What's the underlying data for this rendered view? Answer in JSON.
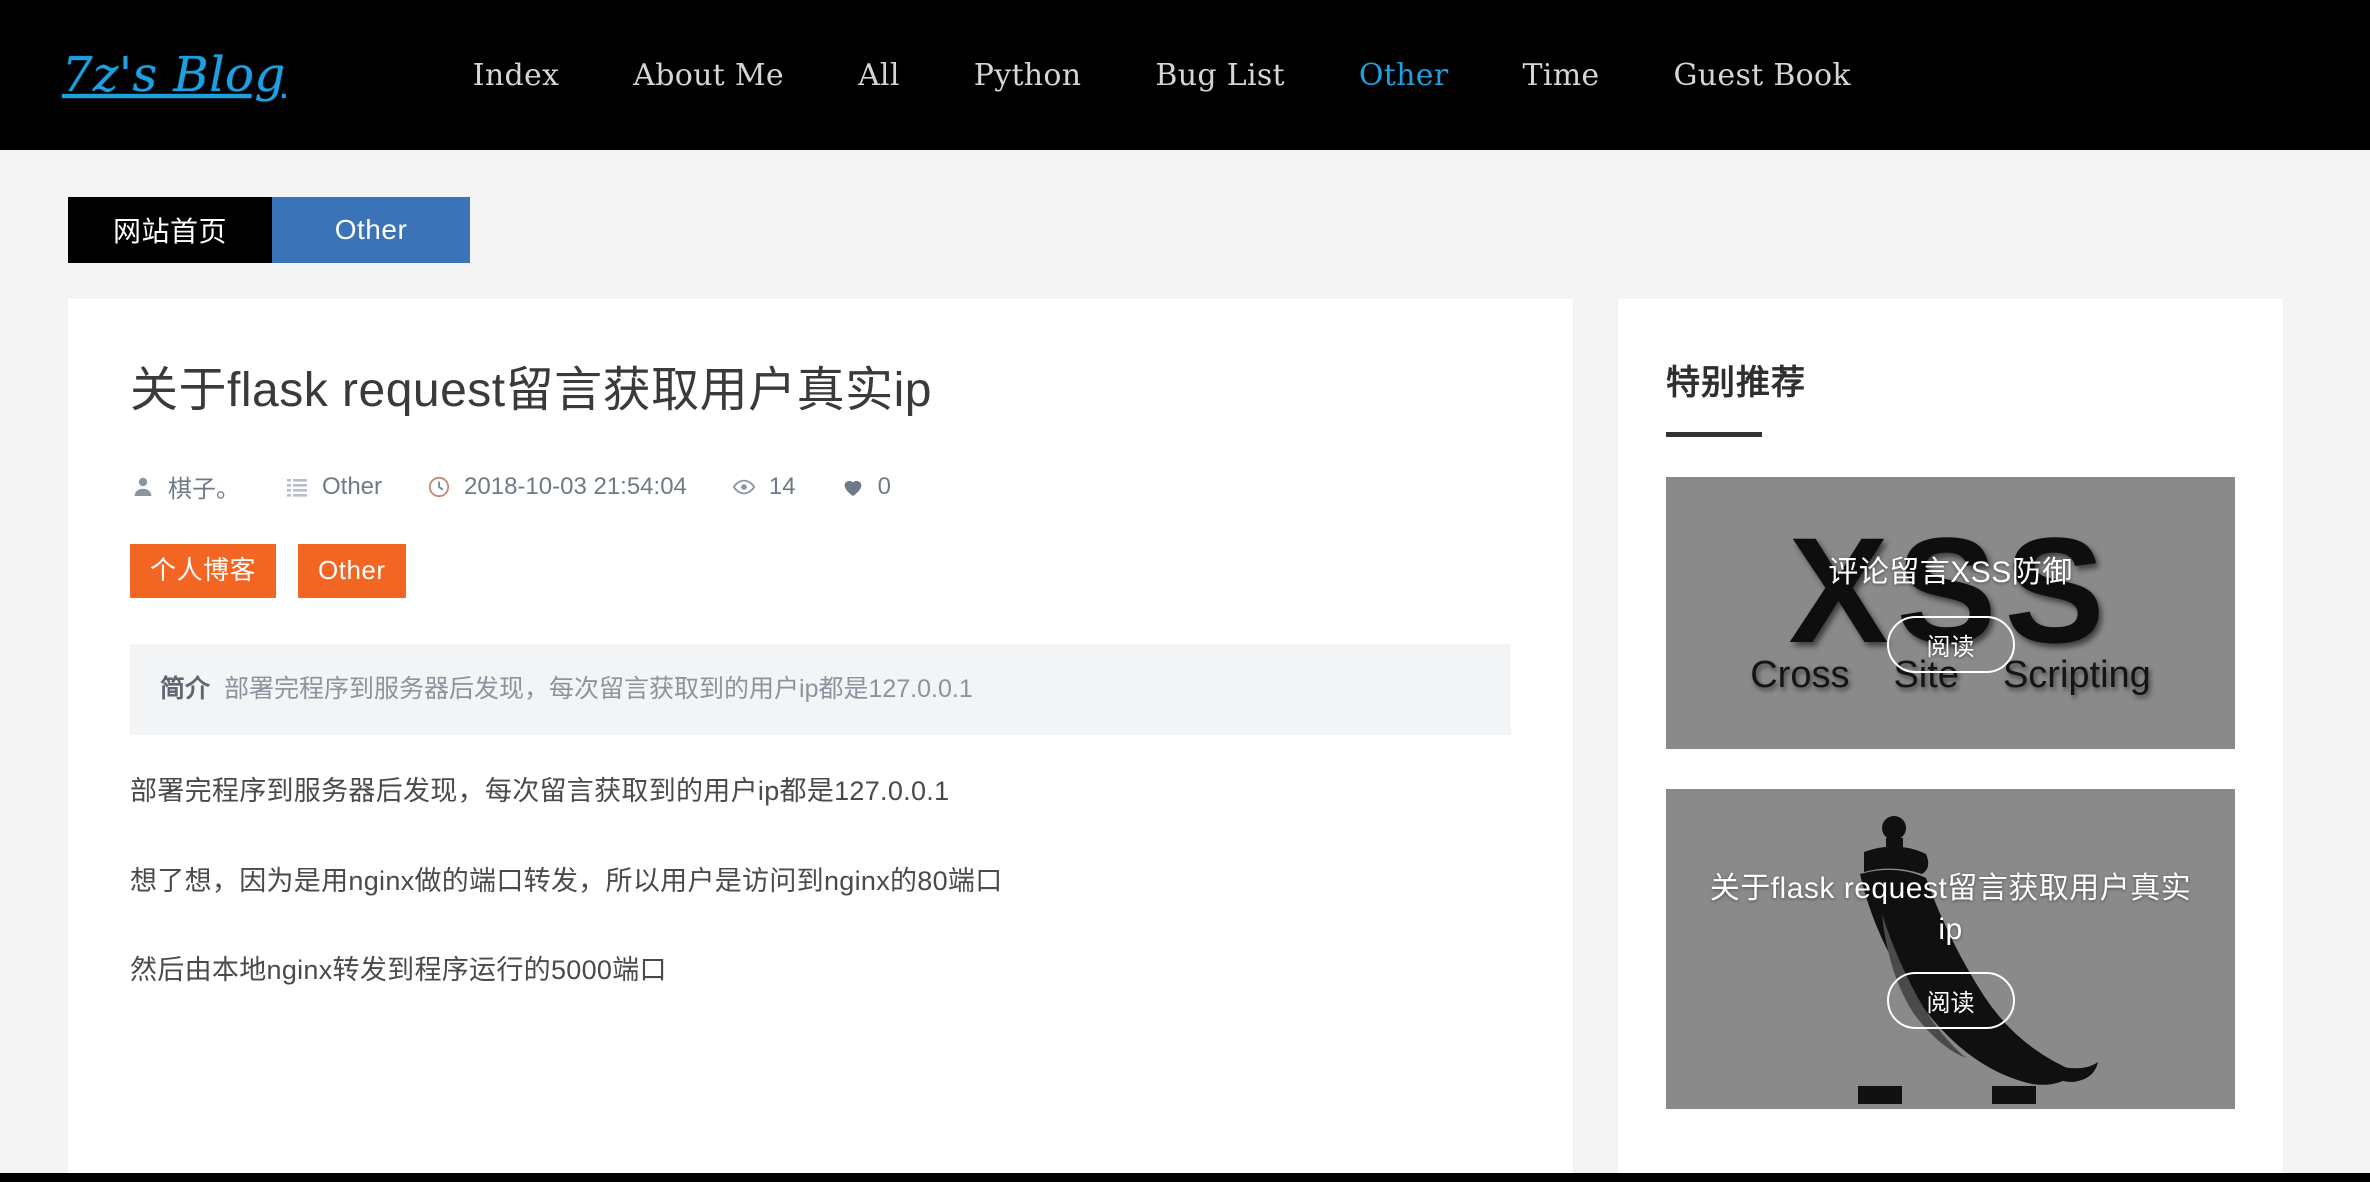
{
  "header": {
    "brand": "7z's Blog",
    "nav": [
      {
        "label": "Index",
        "active": false
      },
      {
        "label": "About Me",
        "active": false
      },
      {
        "label": "All",
        "active": false
      },
      {
        "label": "Python",
        "active": false
      },
      {
        "label": "Bug List",
        "active": false
      },
      {
        "label": "Other",
        "active": true
      },
      {
        "label": "Time",
        "active": false
      },
      {
        "label": "Guest Book",
        "active": false
      }
    ]
  },
  "breadcrumb": {
    "home_tab": "网站首页",
    "category_tab": "Other"
  },
  "article": {
    "title": "关于flask request留言获取用户真实ip",
    "meta": {
      "author_icon": "user-icon",
      "author": "棋子。",
      "category_icon": "list-icon",
      "category": "Other",
      "time_icon": "clock-icon",
      "datetime": "2018-10-03 21:54:04",
      "views_icon": "eye-icon",
      "views": "14",
      "likes_icon": "heart-icon",
      "likes": "0"
    },
    "tags": [
      "个人博客",
      "Other"
    ],
    "summary": {
      "label": "简介",
      "text": "部署完程序到服务器后发现，每次留言获取到的用户ip都是127.0.0.1"
    },
    "paragraphs": [
      "部署完程序到服务器后发现，每次留言获取到的用户ip都是127.0.0.1",
      "想了想，因为是用nginx做的端口转发，所以用户是访问到nginx的80端口",
      "然后由本地nginx转发到程序运行的5000端口"
    ]
  },
  "sidebar": {
    "title": "特别推荐",
    "cards": [
      {
        "title": "评论留言XSS防御",
        "button": "阅读",
        "art": "xss-poster",
        "art_text": {
          "big": "XSS",
          "sub": [
            "Cross",
            "Site",
            "Scripting"
          ]
        }
      },
      {
        "title": "关于flask request留言获取用户真实ip",
        "button": "阅读",
        "art": "horn-illustration"
      }
    ]
  },
  "colors": {
    "brand_blue": "#1e9fe0",
    "tab_blue": "#3b73b9",
    "tag_orange": "#f26522",
    "header_black": "#000000",
    "page_bg": "#f4f4f4"
  }
}
